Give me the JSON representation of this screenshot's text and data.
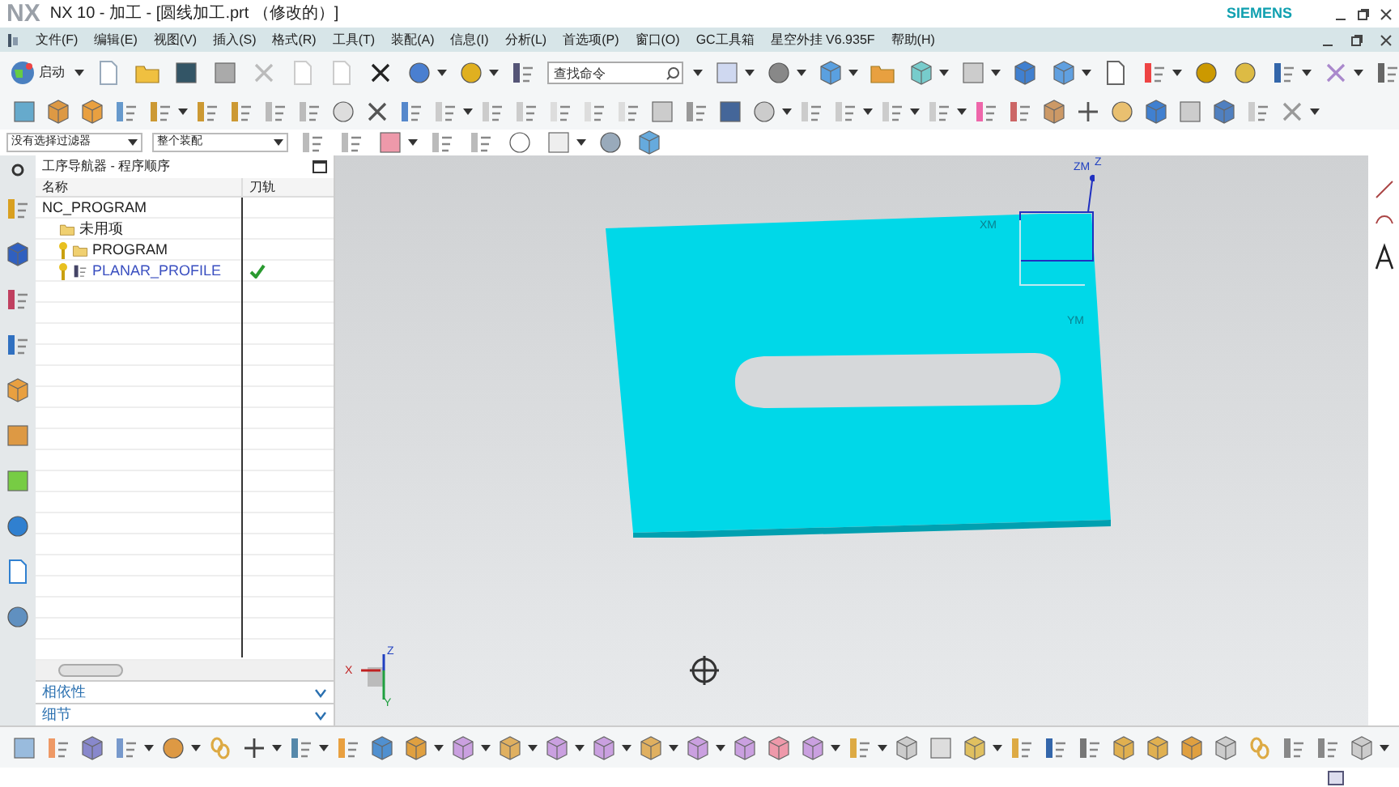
{
  "window": {
    "logo": "NX",
    "title": "NX 10 - 加工 - [圆线加工.prt （修改的）]",
    "brand": "SIEMENS"
  },
  "menu": [
    "文件(F)",
    "编辑(E)",
    "视图(V)",
    "插入(S)",
    "格式(R)",
    "工具(T)",
    "装配(A)",
    "信息(I)",
    "分析(L)",
    "首选项(P)",
    "窗口(O)",
    "GC工具箱",
    "星空外挂 V6.935F",
    "帮助(H)"
  ],
  "start_button": "启动",
  "search": {
    "placeholder": "查找命令"
  },
  "filters": [
    {
      "value": "没有选择过滤器"
    },
    {
      "value": "整个装配"
    }
  ],
  "navigator": {
    "title": "工序导航器 - 程序顺序",
    "columns": [
      "名称",
      "刀轨"
    ],
    "tree": [
      {
        "name": "NC_PROGRAM",
        "selected": false,
        "generated": false,
        "children": [
          {
            "name": "未用项",
            "kind": "group",
            "selected": false,
            "generated": false
          },
          {
            "name": "PROGRAM",
            "kind": "program",
            "selected": false,
            "generated": false
          },
          {
            "name": "PLANAR_PROFILE",
            "kind": "operation",
            "selected": true,
            "generated": true
          }
        ]
      }
    ],
    "panels": [
      {
        "label": "相依性",
        "expanded": false
      },
      {
        "label": "细节",
        "expanded": false
      }
    ]
  },
  "viewport": {
    "wcs_labels": [
      "ZM",
      "Z",
      "XM",
      "YM"
    ],
    "triad_labels": [
      "X",
      "Z",
      "Y"
    ]
  }
}
